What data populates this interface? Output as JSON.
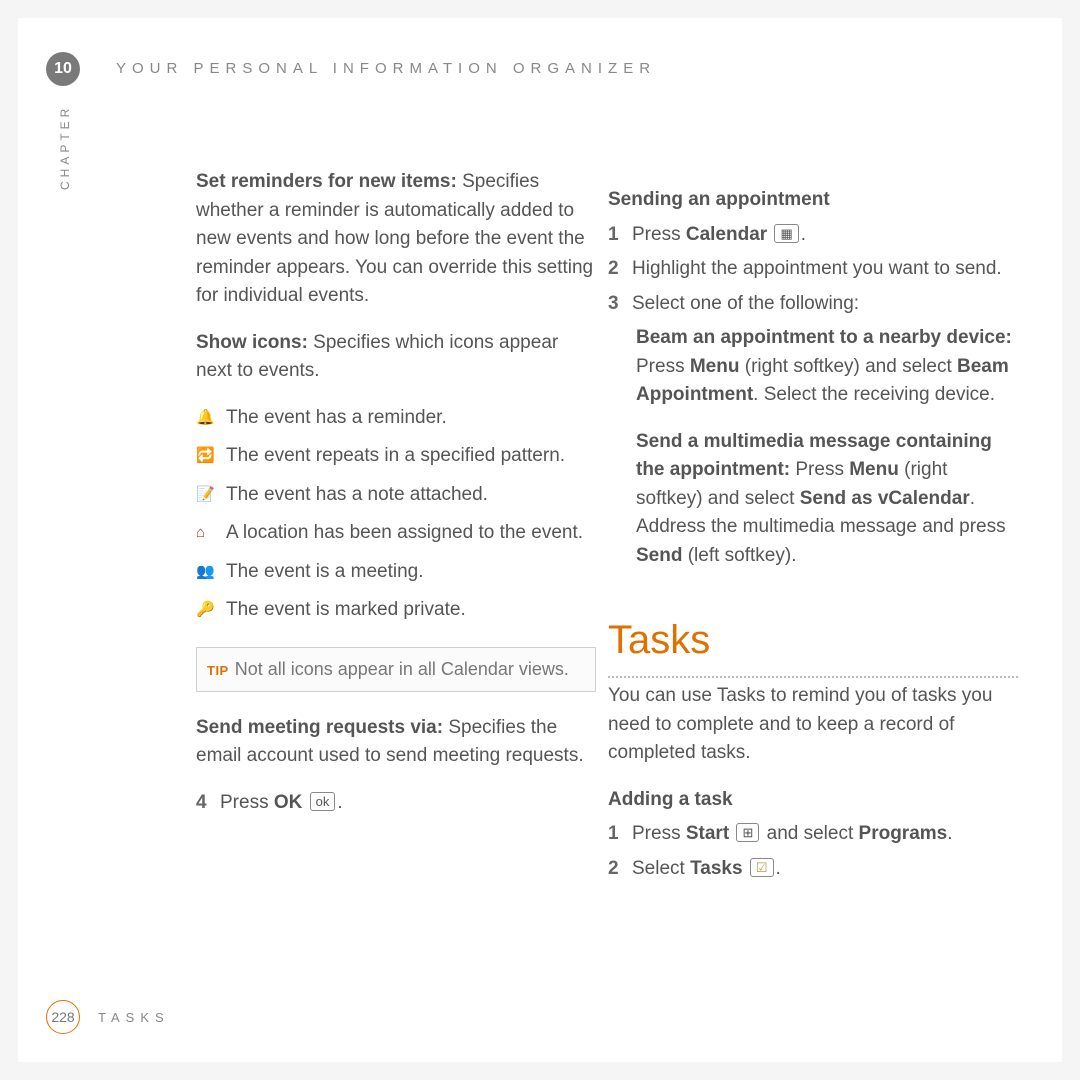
{
  "header": {
    "chapter_number": "10",
    "title": "YOUR PERSONAL INFORMATION ORGANIZER",
    "side_label": "CHAPTER"
  },
  "left": {
    "set_reminders": {
      "heading": "Set reminders for new items:",
      "body": " Specifies whether a reminder is automatically added to new events and how long before the event the reminder appears. You can override this setting for individual events."
    },
    "show_icons": {
      "heading": "Show icons:",
      "body": " Specifies which icons appear next to events."
    },
    "icons": [
      {
        "glyph": "🔔",
        "cls": "bell",
        "text": " The event has a reminder."
      },
      {
        "glyph": "🔁",
        "cls": "repeat",
        "text": " The event repeats in a specified pattern."
      },
      {
        "glyph": "📝",
        "cls": "note",
        "text": " The event has a note attached."
      },
      {
        "glyph": "⌂",
        "cls": "loc",
        "text": " A location has been assigned to the event."
      },
      {
        "glyph": "👥",
        "cls": "meeting",
        "text": " The event is a meeting."
      },
      {
        "glyph": "🔑",
        "cls": "key",
        "text": " The event is marked private."
      }
    ],
    "tip": {
      "label": "TIP",
      "body": "Not all icons appear in all Calendar views."
    },
    "send_meeting": {
      "heading": "Send meeting requests via:",
      "body": " Specifies the email account used to send meeting requests."
    },
    "step4": {
      "num": "4",
      "pre": "Press ",
      "bold": "OK",
      "key": "ok",
      "post": "."
    }
  },
  "right": {
    "sending": {
      "heading": "Sending an appointment",
      "step1": {
        "num": "1",
        "pre": "Press ",
        "bold": "Calendar",
        "key": "▦",
        "post": "."
      },
      "step2": {
        "num": "2",
        "text": "Highlight the appointment you want to send."
      },
      "step3": {
        "num": "3",
        "text": "Select one of the following:"
      },
      "opt1": {
        "b1": "Beam an appointment to a nearby device:",
        "t1": " Press ",
        "b2": "Menu",
        "t2": " (right softkey) and select ",
        "b3": "Beam Appointment",
        "t3": ". Select the receiving device."
      },
      "opt2": {
        "b1": "Send a multimedia message containing the appointment:",
        "t1": " Press ",
        "b2": "Menu",
        "t2": " (right softkey) and select ",
        "b3": "Send as vCalendar",
        "t3": ". Address the multimedia message and press ",
        "b4": "Send",
        "t4": " (left softkey)."
      }
    },
    "tasks": {
      "title": "Tasks",
      "intro": "You can use Tasks to remind you of tasks you need to complete and to keep a record of completed tasks.",
      "adding_heading": "Adding a task",
      "step1": {
        "num": "1",
        "pre": "Press ",
        "bold1": "Start",
        "key": "⊞",
        "mid": " and select ",
        "bold2": "Programs",
        "post": "."
      },
      "step2": {
        "num": "2",
        "pre": "Select ",
        "bold": "Tasks",
        "key": "☑",
        "post": "."
      }
    }
  },
  "footer": {
    "page_number": "228",
    "title": "TASKS"
  }
}
